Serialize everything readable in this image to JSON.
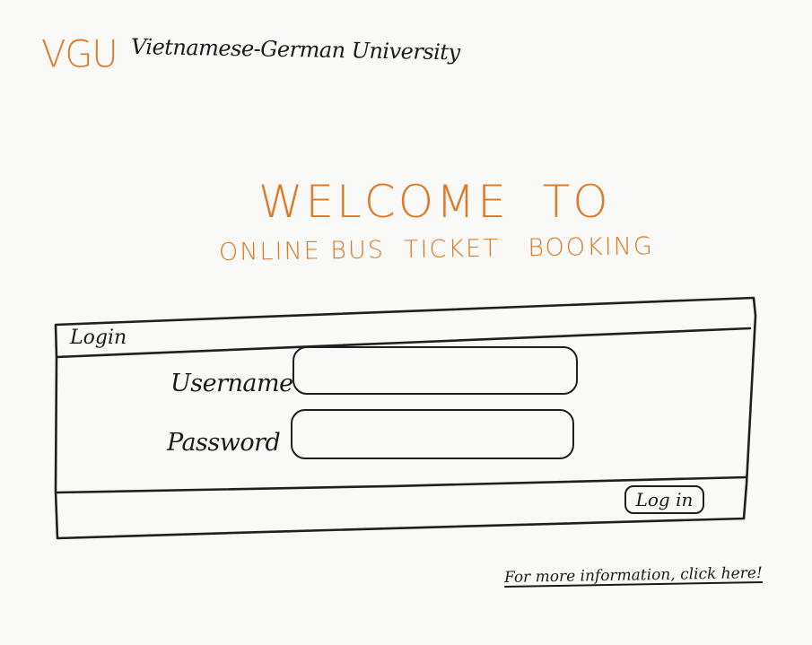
{
  "header": {
    "logo": "VGU",
    "university": "Vietnamese-German University"
  },
  "welcome": {
    "title": "WELCOME  TO",
    "subtitle": "ONLINE BUS  TICKET   BOOKING"
  },
  "login_panel": {
    "title": "Login",
    "username_label": "Username",
    "username_value": "",
    "password_label": "Password",
    "password_value": "",
    "login_button": "Log in"
  },
  "footer": {
    "info_link": "For more information, click here!"
  },
  "colors": {
    "accent": "#e07a27",
    "ink": "#1a1a1a",
    "background": "#f9f9f8"
  }
}
